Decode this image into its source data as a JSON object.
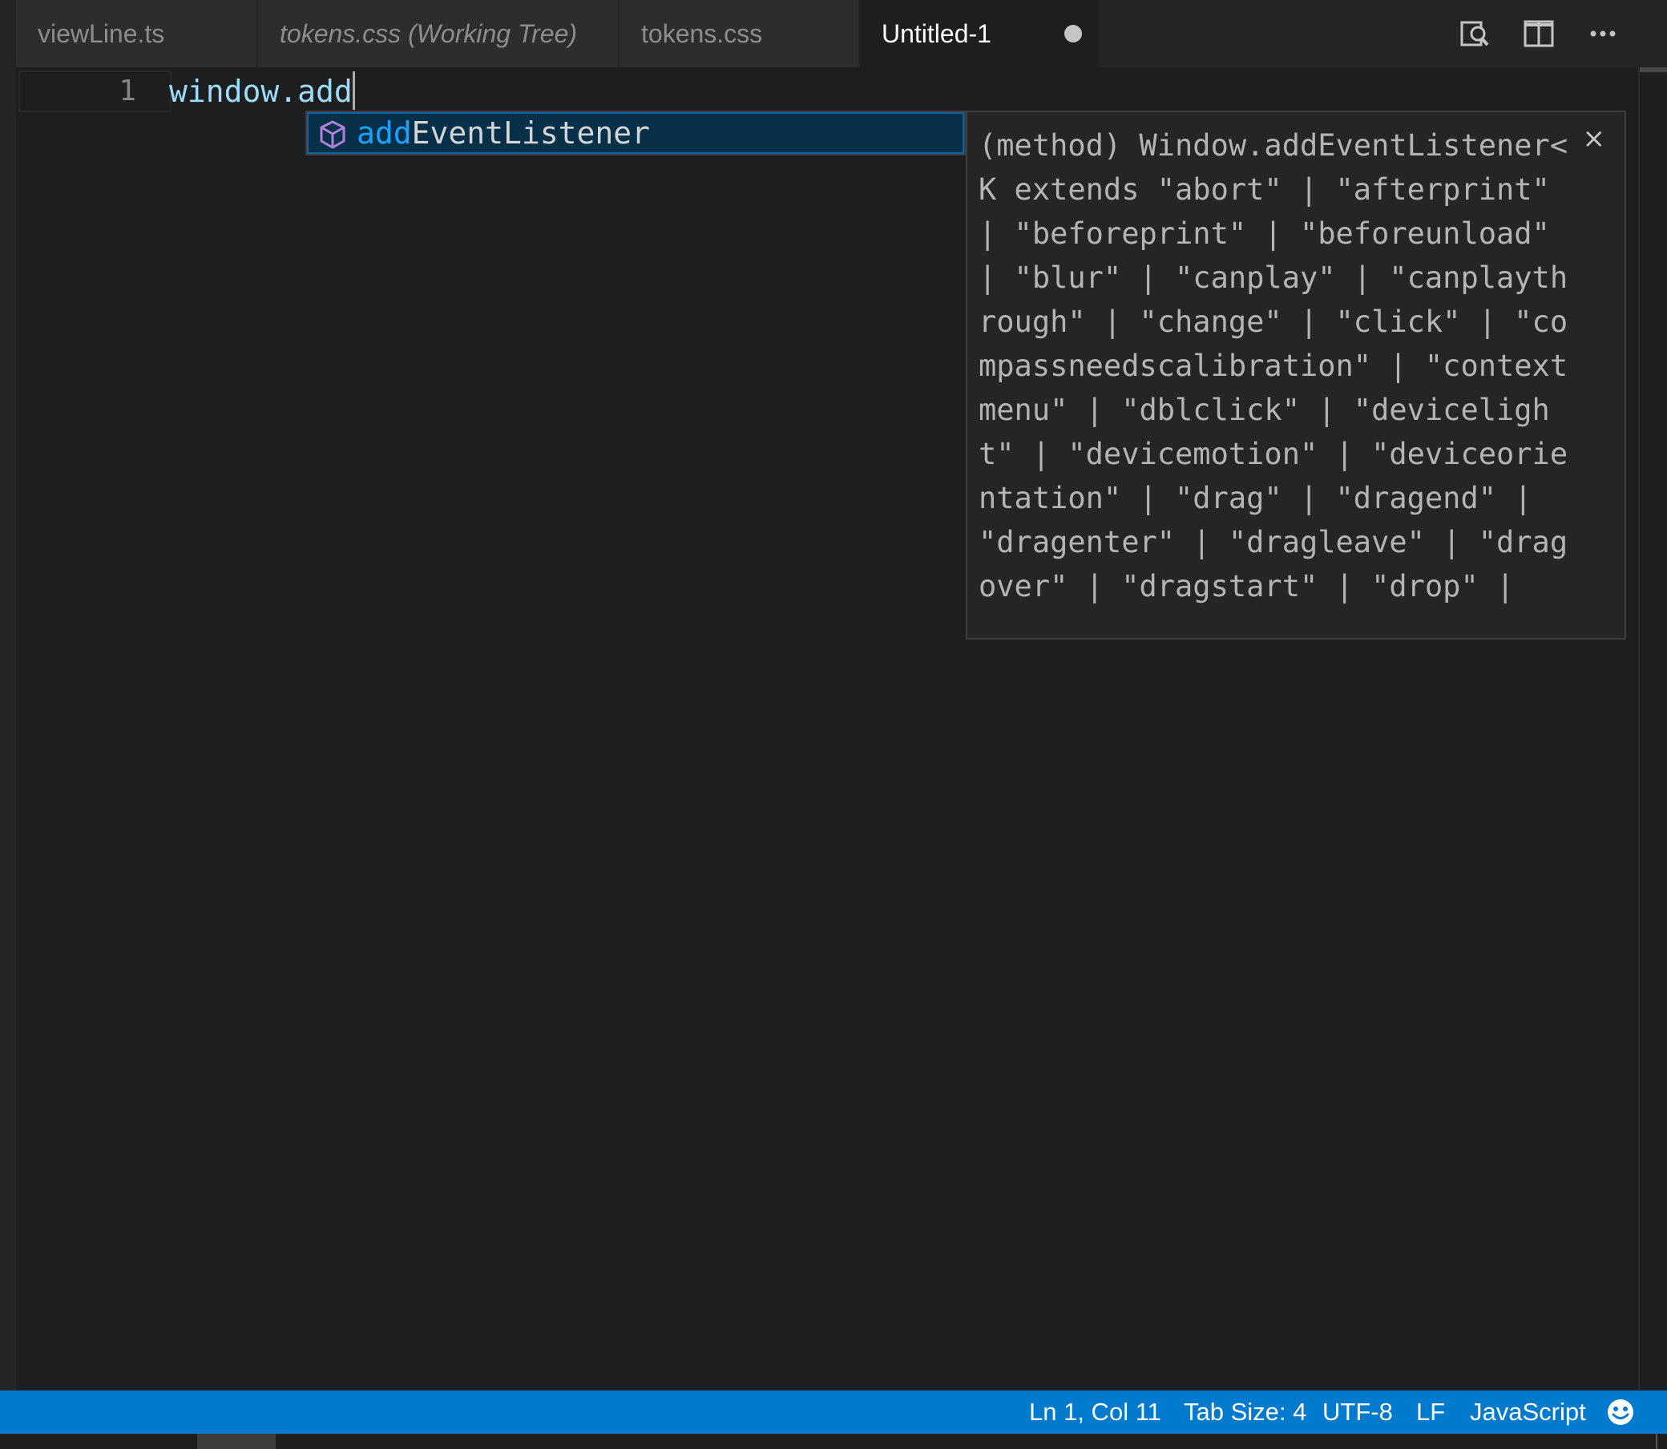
{
  "tabs": [
    {
      "label": "viewLine.ts",
      "italic": false,
      "active": false
    },
    {
      "label": "tokens.css (Working Tree)",
      "italic": true,
      "active": false
    },
    {
      "label": "tokens.css",
      "italic": false,
      "active": false
    },
    {
      "label": "Untitled-1",
      "italic": false,
      "active": true,
      "dirty": true
    }
  ],
  "tab_actions": [
    "open-changes-icon",
    "split-editor-icon",
    "more-actions-icon"
  ],
  "editor": {
    "line_number": "1",
    "code": "window.add"
  },
  "suggest": {
    "icon": "method-cube-icon",
    "match": "add",
    "rest": "EventListener"
  },
  "details": {
    "text": "(method) Window.addEventListener<K extends \"abort\" | \"afterprint\" | \"beforeprint\" | \"beforeunload\" | \"blur\" | \"canplay\" | \"canplaythrough\" | \"change\" | \"click\" | \"compassneedscalibration\" | \"contextmenu\" | \"dblclick\" | \"devicelight\" | \"devicemotion\" | \"deviceorientation\" | \"drag\" | \"dragend\" | \"dragenter\" | \"dragleave\" | \"dragover\" | \"dragstart\" | \"drop\" |",
    "close_label": "×"
  },
  "status": {
    "position": "Ln 1, Col 11",
    "tab_size": "Tab Size: 4",
    "encoding": "UTF-8",
    "eol": "LF",
    "language": "JavaScript",
    "feedback_icon": "smiley-icon"
  },
  "colors": {
    "accent": "#007acc",
    "suggest_selected": "#062f4a",
    "match_highlight": "#18a3ff"
  }
}
